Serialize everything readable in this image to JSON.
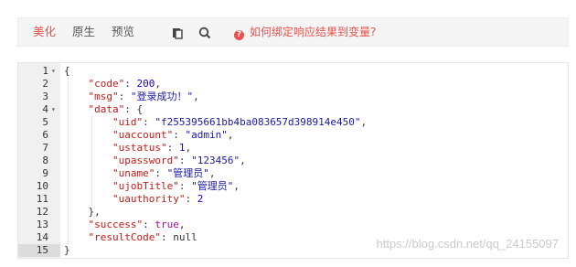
{
  "toolbar": {
    "tabs": [
      "美化",
      "原生",
      "预览"
    ],
    "active_tab": "美化",
    "copy_icon": "copy-icon",
    "search_icon": "search-icon",
    "help_text": "如何绑定响应结果到变量?"
  },
  "editor": {
    "lines": [
      {
        "n": "1",
        "fold": "▾",
        "tokens": [
          {
            "t": "{",
            "c": ""
          }
        ]
      },
      {
        "n": "2",
        "fold": "",
        "tokens": [
          {
            "t": "    ",
            "c": ""
          },
          {
            "t": "\"code\"",
            "c": "key"
          },
          {
            "t": ": ",
            "c": ""
          },
          {
            "t": "200",
            "c": "num"
          },
          {
            "t": ",",
            "c": ""
          }
        ]
      },
      {
        "n": "3",
        "fold": "",
        "tokens": [
          {
            "t": "    ",
            "c": ""
          },
          {
            "t": "\"msg\"",
            "c": "key"
          },
          {
            "t": ": ",
            "c": ""
          },
          {
            "t": "\"登录成功！\"",
            "c": "str"
          },
          {
            "t": ",",
            "c": ""
          }
        ]
      },
      {
        "n": "4",
        "fold": "▾",
        "tokens": [
          {
            "t": "    ",
            "c": ""
          },
          {
            "t": "\"data\"",
            "c": "key"
          },
          {
            "t": ": {",
            "c": ""
          }
        ]
      },
      {
        "n": "5",
        "fold": "",
        "tokens": [
          {
            "t": "        ",
            "c": ""
          },
          {
            "t": "\"uid\"",
            "c": "key"
          },
          {
            "t": ": ",
            "c": ""
          },
          {
            "t": "\"f255395661bb4ba083657d398914e450\"",
            "c": "str"
          },
          {
            "t": ",",
            "c": ""
          }
        ]
      },
      {
        "n": "6",
        "fold": "",
        "tokens": [
          {
            "t": "        ",
            "c": ""
          },
          {
            "t": "\"uaccount\"",
            "c": "key"
          },
          {
            "t": ": ",
            "c": ""
          },
          {
            "t": "\"admin\"",
            "c": "str"
          },
          {
            "t": ",",
            "c": ""
          }
        ]
      },
      {
        "n": "7",
        "fold": "",
        "tokens": [
          {
            "t": "        ",
            "c": ""
          },
          {
            "t": "\"ustatus\"",
            "c": "key"
          },
          {
            "t": ": ",
            "c": ""
          },
          {
            "t": "1",
            "c": "num"
          },
          {
            "t": ",",
            "c": ""
          }
        ]
      },
      {
        "n": "8",
        "fold": "",
        "tokens": [
          {
            "t": "        ",
            "c": ""
          },
          {
            "t": "\"upassword\"",
            "c": "key"
          },
          {
            "t": ": ",
            "c": ""
          },
          {
            "t": "\"123456\"",
            "c": "str"
          },
          {
            "t": ",",
            "c": ""
          }
        ]
      },
      {
        "n": "9",
        "fold": "",
        "tokens": [
          {
            "t": "        ",
            "c": ""
          },
          {
            "t": "\"uname\"",
            "c": "key"
          },
          {
            "t": ": ",
            "c": ""
          },
          {
            "t": "\"管理员\"",
            "c": "str"
          },
          {
            "t": ",",
            "c": ""
          }
        ]
      },
      {
        "n": "10",
        "fold": "",
        "tokens": [
          {
            "t": "        ",
            "c": ""
          },
          {
            "t": "\"ujobTitle\"",
            "c": "key"
          },
          {
            "t": ": ",
            "c": ""
          },
          {
            "t": "\"管理员\"",
            "c": "str"
          },
          {
            "t": ",",
            "c": ""
          }
        ]
      },
      {
        "n": "11",
        "fold": "",
        "tokens": [
          {
            "t": "        ",
            "c": ""
          },
          {
            "t": "\"uauthority\"",
            "c": "key"
          },
          {
            "t": ": ",
            "c": ""
          },
          {
            "t": "2",
            "c": "num"
          }
        ]
      },
      {
        "n": "12",
        "fold": "",
        "tokens": [
          {
            "t": "    },",
            "c": ""
          }
        ]
      },
      {
        "n": "13",
        "fold": "",
        "tokens": [
          {
            "t": "    ",
            "c": ""
          },
          {
            "t": "\"success\"",
            "c": "key"
          },
          {
            "t": ": ",
            "c": ""
          },
          {
            "t": "true",
            "c": "bool"
          },
          {
            "t": ",",
            "c": ""
          }
        ]
      },
      {
        "n": "14",
        "fold": "",
        "tokens": [
          {
            "t": "    ",
            "c": ""
          },
          {
            "t": "\"resultCode\"",
            "c": "key"
          },
          {
            "t": ": null",
            "c": ""
          }
        ]
      },
      {
        "n": "15",
        "fold": "",
        "tokens": [
          {
            "t": "}",
            "c": ""
          }
        ]
      }
    ],
    "active_line": "15"
  },
  "watermark": "https://blog.csdn.net/qq_24155097",
  "colors": {
    "accent": "#e8514d",
    "key": "#c41a16",
    "string": "#1a1aa6",
    "number": "#1c00cf",
    "boolean": "#aa0d91"
  }
}
